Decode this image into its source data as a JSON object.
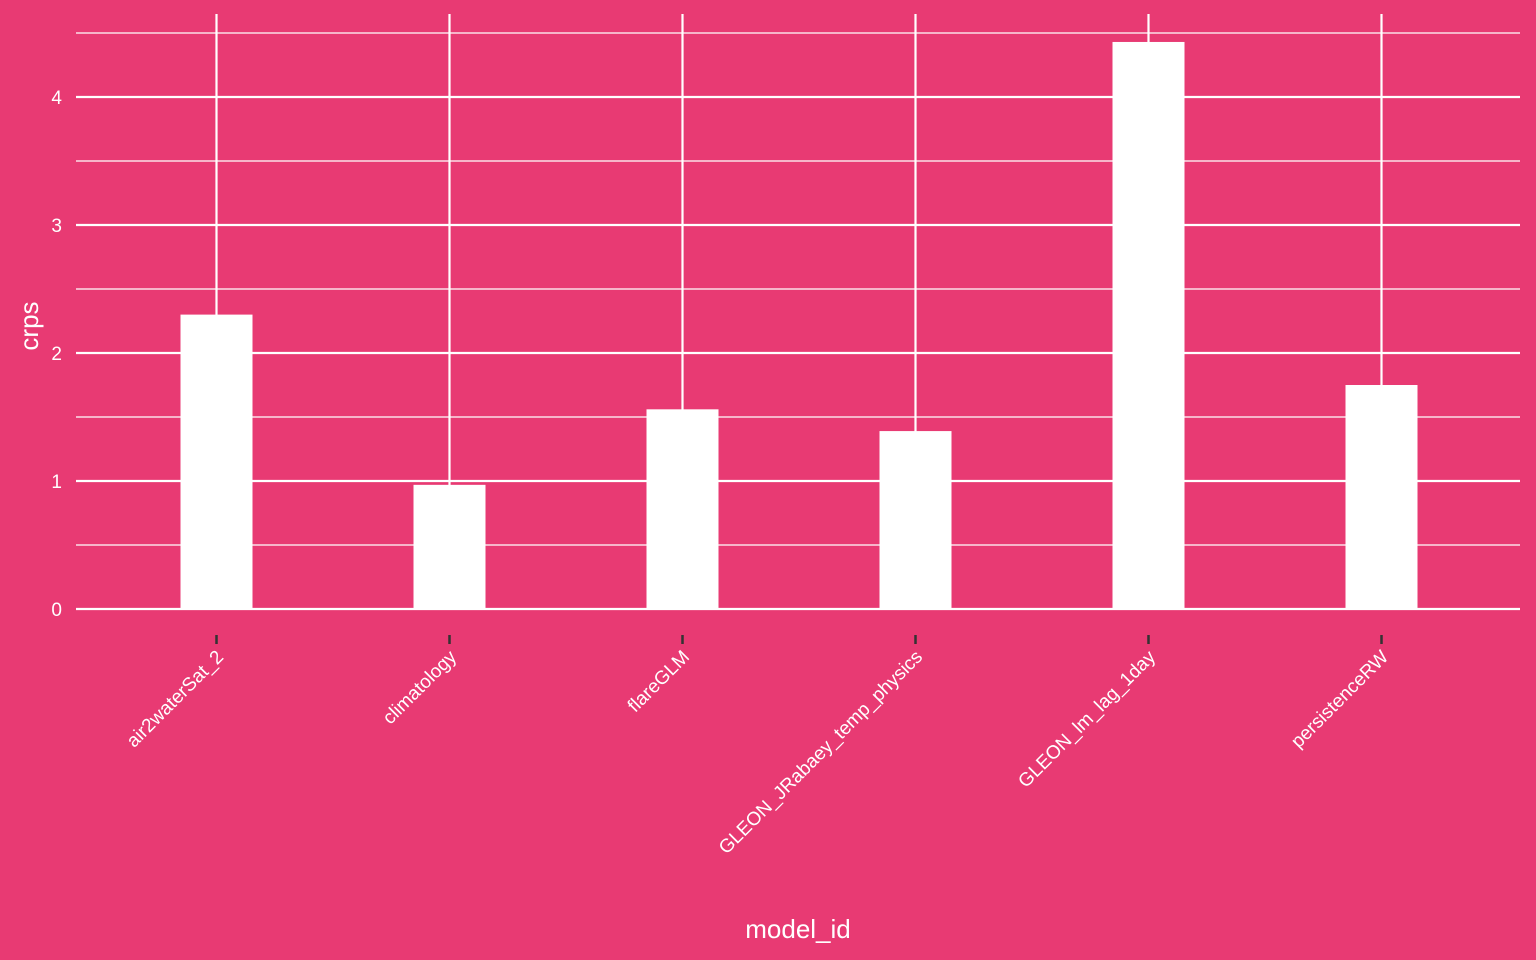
{
  "colors": {
    "background": "#e83a73",
    "bar": "#ffffff",
    "grid": "#ffffff",
    "tick": "#333333",
    "text": "#ffffff"
  },
  "chart_data": {
    "type": "bar",
    "categories": [
      "air2waterSat_2",
      "climatology",
      "flareGLM",
      "GLEON_JRabaey_temp_physics",
      "GLEON_lm_lag_1day",
      "persistenceRW"
    ],
    "values": [
      2.3,
      0.97,
      1.56,
      1.39,
      4.43,
      1.75
    ],
    "xlabel": "model_id",
    "ylabel": "crps",
    "ylim": [
      0,
      4.5
    ],
    "yticks": [
      0,
      1,
      2,
      3,
      4
    ],
    "grid": true,
    "legend": "none"
  }
}
